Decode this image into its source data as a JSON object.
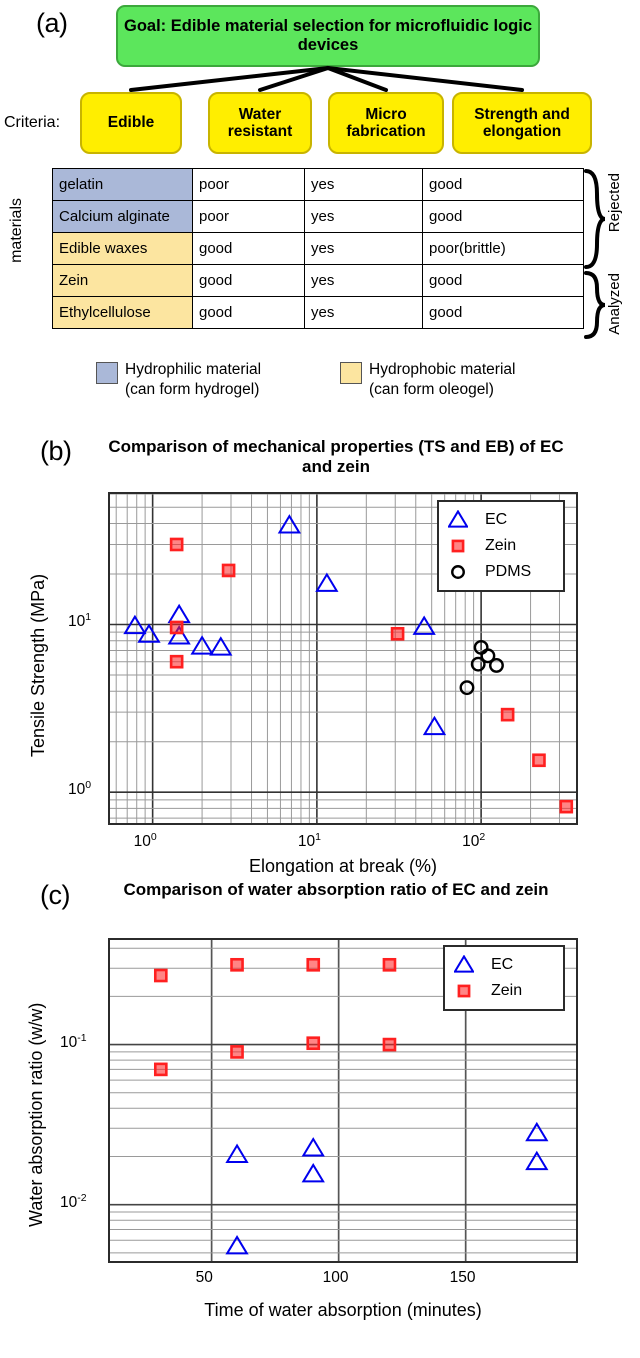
{
  "panels": {
    "a": {
      "letter": "(a)"
    },
    "b": {
      "letter": "(b)"
    },
    "c": {
      "letter": "(c)"
    }
  },
  "diagram": {
    "goal": "Goal: Edible material selection for microfluidic logic devices",
    "criteria_label": "Criteria:",
    "criteria": [
      {
        "label": "Edible"
      },
      {
        "label": "Water resistant"
      },
      {
        "label": "Micro fabrication"
      },
      {
        "label": "Strength and elongation"
      }
    ]
  },
  "table": {
    "row_axis_label": "materials",
    "rows": [
      {
        "name": "gelatin",
        "fill": "hydrophilic",
        "cells": [
          "poor",
          "yes",
          "good"
        ],
        "flags": [
          "bad",
          "",
          ""
        ]
      },
      {
        "name": "Calcium alginate",
        "fill": "hydrophilic",
        "cells": [
          "poor",
          "yes",
          "good"
        ],
        "flags": [
          "bad",
          "",
          ""
        ]
      },
      {
        "name": "Edible waxes",
        "fill": "hydrophobic",
        "cells": [
          "good",
          "yes",
          "poor(brittle)"
        ],
        "flags": [
          "",
          "",
          "bad"
        ]
      },
      {
        "name": "Zein",
        "fill": "hydrophobic",
        "cells": [
          "good",
          "yes",
          "good"
        ],
        "flags": [
          "",
          "",
          ""
        ]
      },
      {
        "name": "Ethylcellulose",
        "fill": "hydrophobic",
        "cells": [
          "good",
          "yes",
          "good"
        ],
        "flags": [
          "",
          "",
          ""
        ]
      }
    ],
    "braces": [
      {
        "label": "Rejected"
      },
      {
        "label": "Analyzed"
      }
    ]
  },
  "key": [
    {
      "swatch": "blue",
      "line1": "Hydrophilic material",
      "line2": "(can form hydrogel)"
    },
    {
      "swatch": "yellow",
      "line1": "Hydrophobic material",
      "line2": "(can form oleogel)"
    }
  ],
  "colors": {
    "goal_fill": "#5ce65c",
    "criteria_fill": "#ffee00",
    "hydrophilic": "#aab8d8",
    "hydrophobic": "#fce5a0",
    "ec_blue": "#0000ee",
    "zein_red": "#ff2020",
    "pdms_black": "#000000",
    "bad_text": "#ff0000"
  },
  "chart_data": [
    {
      "type": "scatter",
      "panel": "b",
      "title": "Comparison of mechanical properties (TS and EB) of EC and zein",
      "xlabel": "Elongation at break (%)",
      "ylabel": "Tensile Strength (MPa)",
      "xscale": "log",
      "yscale": "log",
      "xlim": [
        0.55,
        400
      ],
      "ylim": [
        0.62,
        60
      ],
      "xticks": [
        "10⁰",
        "10¹",
        "10²"
      ],
      "xtick_values": [
        1,
        10,
        100
      ],
      "yticks": [
        "10⁰",
        "10¹"
      ],
      "ytick_values": [
        1,
        10
      ],
      "grid": "minor-log-both",
      "legend_position": "top-right",
      "series": [
        {
          "name": "EC",
          "marker": "triangle",
          "color": "#0000ee",
          "points": [
            {
              "x": 0.78,
              "y": 9.8
            },
            {
              "x": 0.95,
              "y": 8.7
            },
            {
              "x": 1.45,
              "y": 11.4
            },
            {
              "x": 1.45,
              "y": 8.5
            },
            {
              "x": 2.0,
              "y": 7.4
            },
            {
              "x": 2.6,
              "y": 7.3
            },
            {
              "x": 6.8,
              "y": 39.0
            },
            {
              "x": 11.5,
              "y": 17.5
            },
            {
              "x": 45.0,
              "y": 9.7
            },
            {
              "x": 52.0,
              "y": 2.45
            }
          ]
        },
        {
          "name": "Zein",
          "marker": "square",
          "color": "#ff2020",
          "points": [
            {
              "x": 1.4,
              "y": 30.0
            },
            {
              "x": 1.4,
              "y": 9.6
            },
            {
              "x": 1.4,
              "y": 6.0
            },
            {
              "x": 2.9,
              "y": 21.0
            },
            {
              "x": 31.0,
              "y": 8.8
            },
            {
              "x": 145.0,
              "y": 2.9
            },
            {
              "x": 225.0,
              "y": 1.55
            },
            {
              "x": 330.0,
              "y": 0.82
            }
          ]
        },
        {
          "name": "PDMS",
          "marker": "circle",
          "color": "#000000",
          "points": [
            {
              "x": 100.0,
              "y": 7.3
            },
            {
              "x": 110.0,
              "y": 6.5
            },
            {
              "x": 96.0,
              "y": 5.8
            },
            {
              "x": 124.0,
              "y": 5.7
            },
            {
              "x": 82.0,
              "y": 4.2
            }
          ]
        }
      ]
    },
    {
      "type": "scatter",
      "panel": "c",
      "title": "Comparison of water absorption ratio of EC and zein",
      "xlabel": "Time of water absorption (minutes)",
      "ylabel": "Water absorption ratio (w/w)",
      "xscale": "linear",
      "yscale": "log",
      "xlim": [
        10,
        195
      ],
      "ylim": [
        0.0042,
        0.45
      ],
      "xticks": [
        "50",
        "100",
        "150"
      ],
      "xtick_values": [
        50,
        100,
        150
      ],
      "yticks": [
        "10⁻¹",
        "10⁻²"
      ],
      "ytick_values": [
        0.1,
        0.01
      ],
      "grid": "minor-log-y",
      "legend_position": "top-right",
      "series": [
        {
          "name": "EC",
          "marker": "triangle",
          "color": "#0000ee",
          "points": [
            {
              "x": 60,
              "y": 0.0205
            },
            {
              "x": 60,
              "y": 0.0055
            },
            {
              "x": 90,
              "y": 0.0225
            },
            {
              "x": 90,
              "y": 0.0155
            },
            {
              "x": 178,
              "y": 0.028
            },
            {
              "x": 178,
              "y": 0.0185
            }
          ]
        },
        {
          "name": "Zein",
          "marker": "square",
          "color": "#ff2020",
          "points": [
            {
              "x": 30,
              "y": 0.27
            },
            {
              "x": 30,
              "y": 0.07
            },
            {
              "x": 60,
              "y": 0.315
            },
            {
              "x": 60,
              "y": 0.09
            },
            {
              "x": 90,
              "y": 0.315
            },
            {
              "x": 90,
              "y": 0.102
            },
            {
              "x": 120,
              "y": 0.315
            },
            {
              "x": 120,
              "y": 0.1
            }
          ]
        }
      ]
    }
  ]
}
